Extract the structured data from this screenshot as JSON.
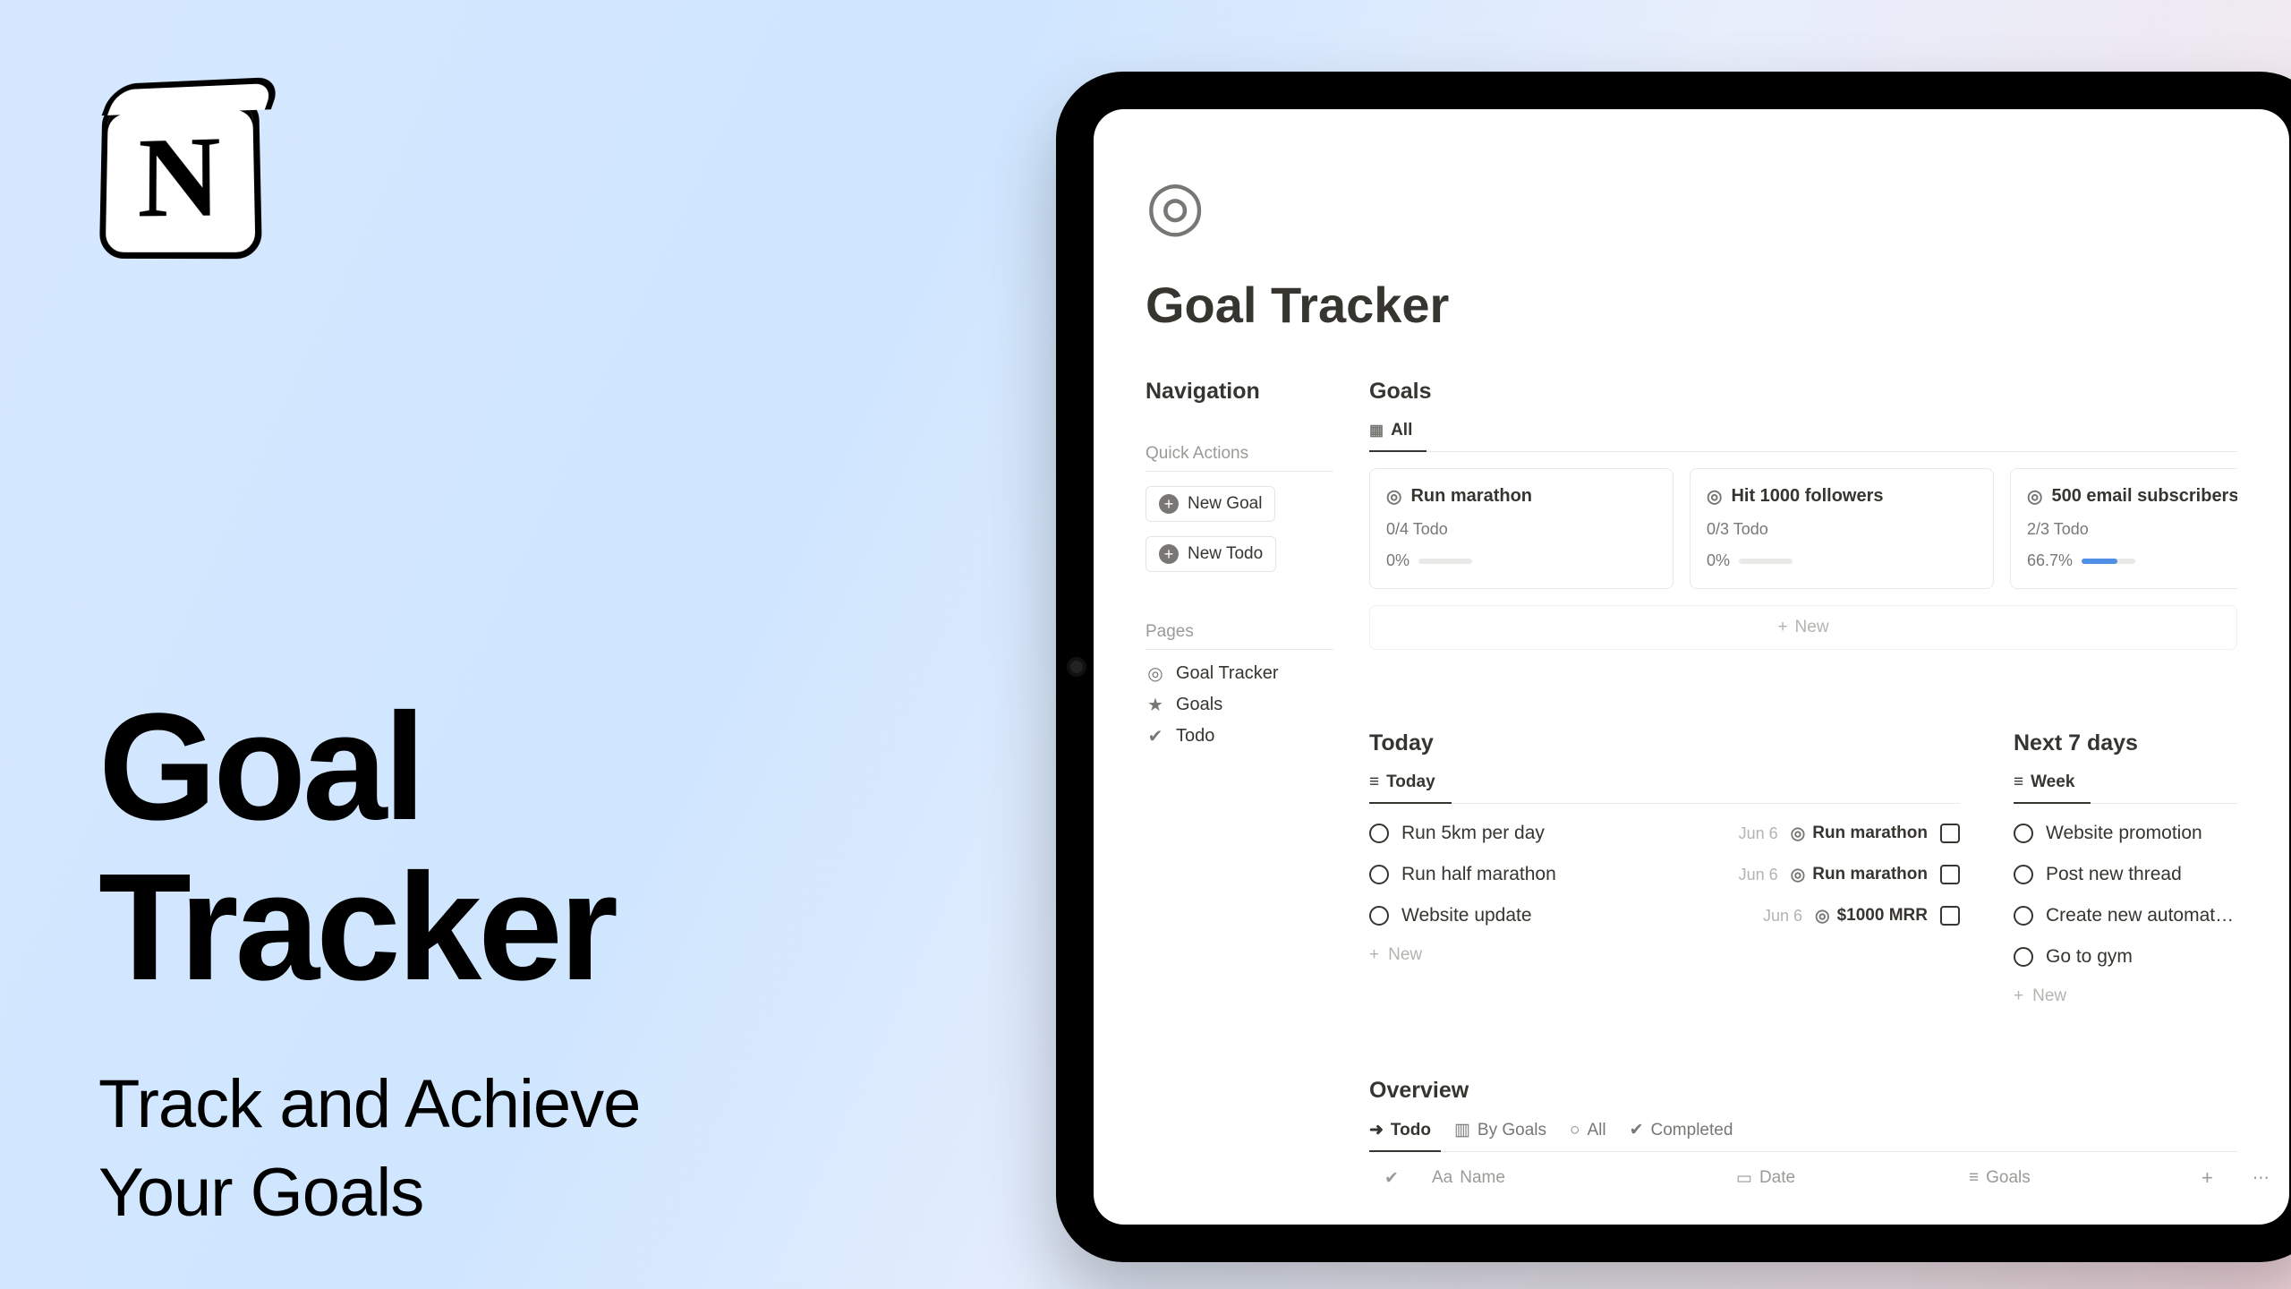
{
  "promo": {
    "title_line1": "Goal",
    "title_line2": "Tracker",
    "subtitle_line1": "Track and Achieve",
    "subtitle_line2": "Your Goals",
    "logo_letter": "N"
  },
  "page": {
    "icon": "target",
    "title": "Goal Tracker"
  },
  "sidebar": {
    "heading": "Navigation",
    "quick_actions_label": "Quick Actions",
    "buttons": [
      {
        "label": "New Goal"
      },
      {
        "label": "New Todo"
      }
    ],
    "pages_label": "Pages",
    "pages": [
      {
        "icon": "target",
        "label": "Goal Tracker"
      },
      {
        "icon": "star",
        "label": "Goals"
      },
      {
        "icon": "check",
        "label": "Todo"
      }
    ]
  },
  "goals": {
    "heading": "Goals",
    "tab_label": "All",
    "cards": [
      {
        "title": "Run marathon",
        "sub": "0/4 Todo",
        "pct": "0%",
        "pct_fill": 0
      },
      {
        "title": "Hit 1000 followers",
        "sub": "0/3 Todo",
        "pct": "0%",
        "pct_fill": 0
      },
      {
        "title": "500 email subscribers",
        "sub": "2/3 Todo",
        "pct": "66.7%",
        "pct_fill": 66.7
      }
    ],
    "new_label": "New"
  },
  "today": {
    "heading": "Today",
    "tab_label": "Today",
    "rows": [
      {
        "title": "Run 5km per day",
        "date": "Jun 6",
        "goal": "Run marathon"
      },
      {
        "title": "Run half marathon",
        "date": "Jun 6",
        "goal": "Run marathon"
      },
      {
        "title": "Website update",
        "date": "Jun 6",
        "goal": "$1000 MRR"
      }
    ],
    "new_label": "New"
  },
  "next7": {
    "heading": "Next 7 days",
    "tab_label": "Week",
    "rows": [
      {
        "title": "Website promotion"
      },
      {
        "title": "Post new thread"
      },
      {
        "title": "Create new automation"
      },
      {
        "title": "Go to gym"
      }
    ],
    "new_label": "New"
  },
  "overview": {
    "heading": "Overview",
    "tabs": [
      {
        "label": "Todo",
        "icon": "arrow"
      },
      {
        "label": "By Goals",
        "icon": "board"
      },
      {
        "label": "All",
        "icon": "circle"
      },
      {
        "label": "Completed",
        "icon": "check"
      }
    ],
    "columns": {
      "name": "Name",
      "date": "Date",
      "goals": "Goals"
    }
  }
}
